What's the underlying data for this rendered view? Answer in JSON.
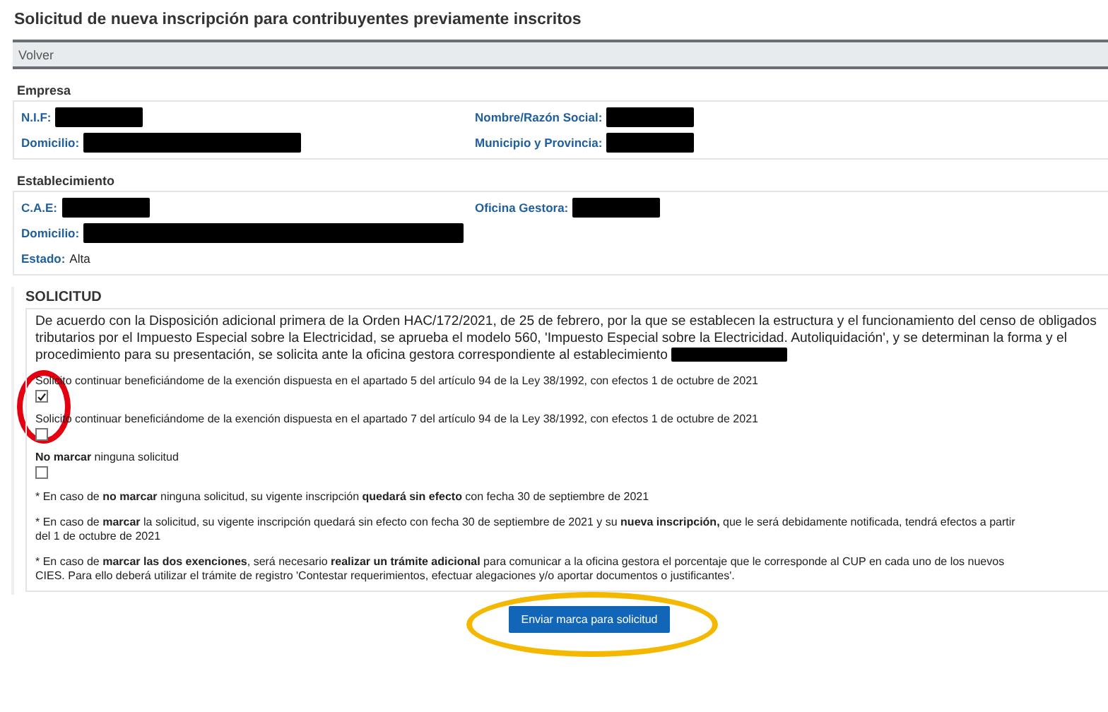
{
  "title": "Solicitud de nueva inscripción para contribuyentes previamente inscritos",
  "back_link": "Volver",
  "sections": [
    {
      "heading": "Empresa",
      "fields": [
        {
          "label": "N.I.F:",
          "redacted": true
        },
        {
          "label": "Nombre/Razón Social:",
          "redacted": true
        },
        {
          "label": "Domicilio:",
          "redacted": true
        },
        {
          "label": "Municipio y Provincia:",
          "redacted": true
        }
      ]
    },
    {
      "heading": "Establecimiento",
      "fields": [
        {
          "label": "C.A.E:",
          "redacted": true
        },
        {
          "label": "Oficina Gestora:",
          "redacted": true
        },
        {
          "label": "Domicilio:",
          "redacted": true,
          "wide": true
        },
        {
          "label": "Estado:",
          "redacted": false,
          "value": "Alta"
        }
      ]
    }
  ],
  "request": {
    "heading": "SOLICITUD",
    "intro": "De acuerdo con la Disposición adicional primera de la Orden HAC/172/2021, de 25 de febrero, por la que se establecen la estructura y el funcionamiento del censo de obligados tributarios por el Impuesto Especial sobre la Electricidad, se aprueba el modelo 560, 'Impuesto Especial sobre la Electricidad. Autoliquidación', y se determinan la forma y el procedimiento para su presentación, se solicita ante la oficina gestora correspondiente al establecimiento",
    "intro_redacted": true,
    "options": [
      {
        "label": "Solicito continuar beneficiándome de la exención dispuesta en el apartado 5 del artículo 94 de la Ley 38/1992, con efectos 1 de octubre de 2021",
        "checked": true
      },
      {
        "label": "Solicito continuar beneficiándome de la exención dispuesta en el apartado 7 del artículo 94 de la Ley 38/1992, con efectos 1 de octubre de 2021",
        "checked": false
      },
      {
        "label": "**No marcar** ninguna solicitud",
        "checked": false
      }
    ],
    "notes": [
      "* En caso de **no marcar** ninguna solicitud, su vigente inscripción **quedará sin efecto** con fecha 30 de septiembre de 2021",
      "* En caso de **marcar** la solicitud, su vigente inscripción quedará sin efecto con fecha 30 de septiembre de 2021 y su **nueva inscripción,** que le será debidamente notificada, tendrá efectos a partir del 1 de octubre de 2021",
      "* En caso de **marcar las dos exenciones**, será necesario **realizar un trámite adicional** para comunicar a la oficina gestora el porcentaje que le corresponde al CUP en cada uno de los nuevos CIES. Para ello deberá utilizar el trámite de registro 'Contestar requerimientos, efectuar alegaciones y/o aportar documentos o justificantes'."
    ]
  },
  "submit_button": "Enviar marca para solicitud",
  "annotations": [
    {
      "kind": "circle",
      "color": "#e3000f"
    },
    {
      "kind": "ellipse",
      "color": "#f5b800"
    }
  ]
}
